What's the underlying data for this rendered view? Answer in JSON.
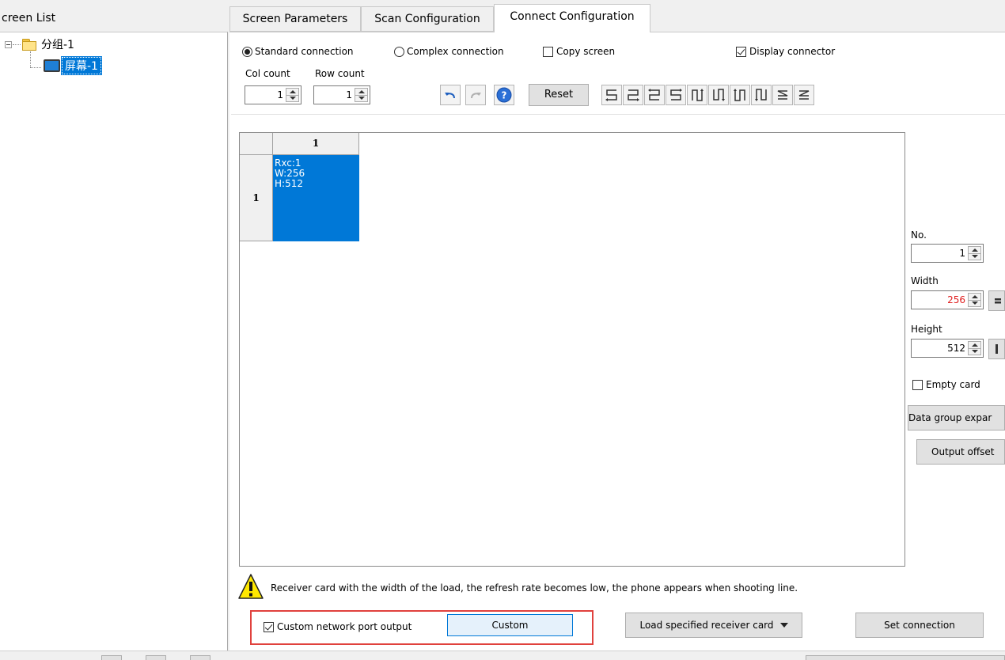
{
  "left": {
    "header": "creen List",
    "tree": [
      {
        "label": "分组-1"
      },
      {
        "label": "屏幕-1"
      }
    ]
  },
  "tabs": [
    {
      "label": "Screen Parameters"
    },
    {
      "label": "Scan Configuration"
    },
    {
      "label": "Connect Configuration"
    }
  ],
  "options": {
    "standard": "Standard connection",
    "complex": "Complex connection",
    "copy": "Copy screen",
    "display": "Display connector"
  },
  "counts": {
    "col_label": "Col count",
    "row_label": "Row count",
    "col_value": "1",
    "row_value": "1"
  },
  "toolbar": {
    "reset": "Reset"
  },
  "grid": {
    "col_header": "1",
    "row_header": "1",
    "cell_lines": [
      "Rxc:1",
      "W:256",
      "H:512"
    ]
  },
  "right_panel": {
    "no_label": "No.",
    "no_value": "1",
    "width_label": "Width",
    "width_value": "256",
    "height_label": "Height",
    "height_value": "512",
    "empty_card": "Empty card",
    "data_group": "Data group expar",
    "output_offset": "Output offset",
    "width_value_color": "#e02020"
  },
  "bottom": {
    "warning": "Receiver card with the width of the load, the refresh rate becomes low, the phone appears when shooting line.",
    "custom_output": "Custom network port output",
    "custom_button": "Custom",
    "load_card": "Load specified receiver card",
    "set_connection": "Set connection"
  },
  "colors": {
    "selection": "#0078d7",
    "highlight_box": "#e0413d"
  }
}
